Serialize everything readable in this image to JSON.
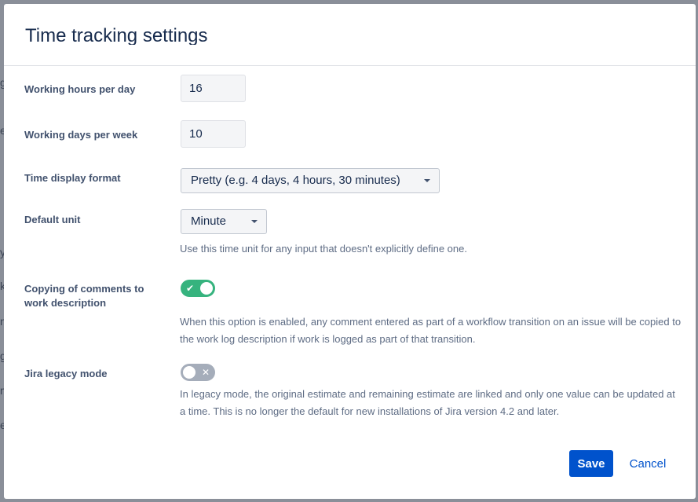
{
  "background": {
    "peek_letters": [
      "g",
      "er",
      "y",
      "k",
      "nt",
      "g",
      "m",
      "e"
    ]
  },
  "dialog": {
    "title": "Time tracking settings"
  },
  "fields": {
    "working_hours": {
      "label": "Working hours per day",
      "value": "16"
    },
    "working_days": {
      "label": "Working days per week",
      "value": "10"
    },
    "display_format": {
      "label": "Time display format",
      "value": "Pretty (e.g. 4 days, 4 hours, 30 minutes)"
    },
    "default_unit": {
      "label": "Default unit",
      "value": "Minute",
      "help": "Use this time unit for any input that doesn't explicitly define one."
    },
    "copy_comments": {
      "label": "Copying of comments to work description",
      "enabled": true,
      "help": "When this option is enabled, any comment entered as part of a workflow transition on an issue will be copied to the work log description if work is logged as part of that transition."
    },
    "legacy_mode": {
      "label": "Jira legacy mode",
      "enabled": false,
      "help": "In legacy mode, the original estimate and remaining estimate are linked and only one value can be updated at a time. This is no longer the default for new installations of Jira version 4.2 and later."
    }
  },
  "icons": {
    "toggle_on": "check-icon",
    "toggle_off": "cross-icon",
    "dropdown": "chevron-down-icon"
  },
  "colors": {
    "primary": "#0052cc",
    "toggle_on": "#36b37e",
    "toggle_off": "#a5adba"
  },
  "actions": {
    "save": "Save",
    "cancel": "Cancel"
  }
}
